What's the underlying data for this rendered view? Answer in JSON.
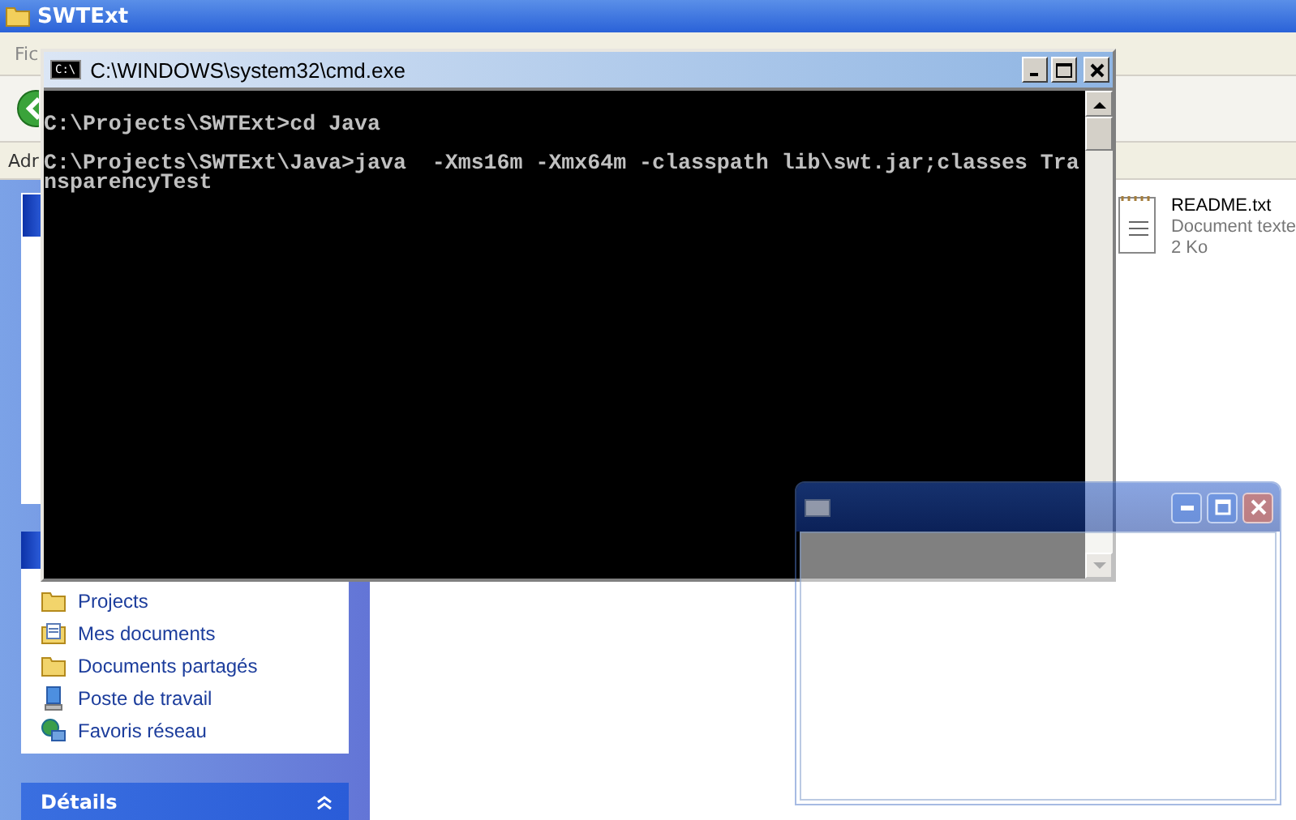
{
  "explorer": {
    "title": "SWTExt",
    "menu_partial": "Fic",
    "address_label": "Adr",
    "places": [
      {
        "label": "Projects",
        "kind": "folder"
      },
      {
        "label": "Mes documents",
        "kind": "documents"
      },
      {
        "label": "Documents partagés",
        "kind": "folder"
      },
      {
        "label": "Poste de travail",
        "kind": "computer"
      },
      {
        "label": "Favoris réseau",
        "kind": "network"
      }
    ],
    "details_header": "Détails",
    "files": [
      {
        "name": "README.txt",
        "type": "Document texte",
        "size": "2 Ko"
      }
    ]
  },
  "console": {
    "title": "C:\\WINDOWS\\system32\\cmd.exe",
    "icon_text": "C:\\",
    "blocks": [
      [
        "C:\\Projects\\SWTExt>cd Java"
      ],
      [
        "C:\\Projects\\SWTExt\\Java>java  -Xms16m -Xmx64m -classpath lib\\swt.jar;classes Tra",
        "nsparencyTest"
      ]
    ]
  }
}
